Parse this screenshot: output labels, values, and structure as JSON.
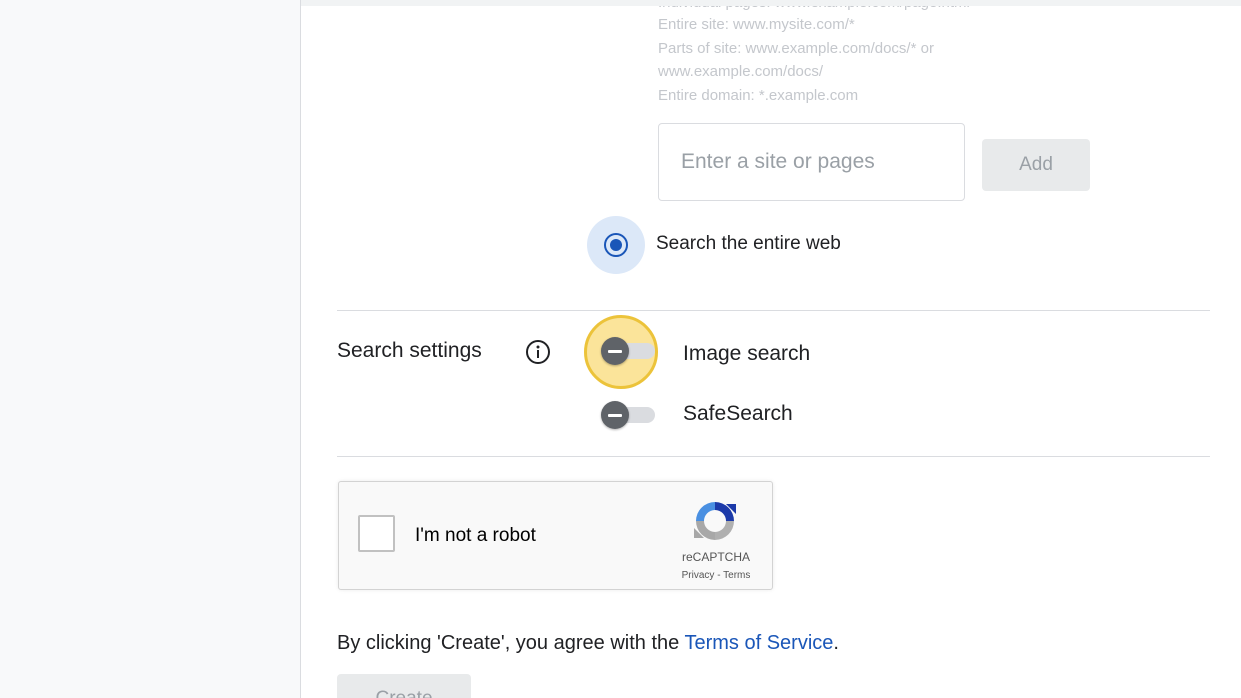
{
  "sites": {
    "hints": [
      "Individual pages: www.example.com/page.html",
      "Entire site: www.mysite.com/*",
      "Parts of site: www.example.com/docs/* or",
      "www.example.com/docs/",
      "Entire domain: *.example.com"
    ],
    "input_placeholder": "Enter a site or pages",
    "add_label": "Add",
    "entire_web_label": "Search the entire web"
  },
  "settings": {
    "label": "Search settings",
    "image_search_label": "Image search",
    "safesearch_label": "SafeSearch"
  },
  "captcha": {
    "label": "I'm not a robot",
    "brand": "reCAPTCHA",
    "privacy": "Privacy",
    "separator": " - ",
    "terms": "Terms"
  },
  "footer": {
    "agree_prefix": "By clicking 'Create', you agree with the ",
    "terms_link": "Terms of Service",
    "agree_suffix": ".",
    "create_label": "Create"
  },
  "colors": {
    "accent": "#1a56b8",
    "highlight": "#fbe49a",
    "toggle_thumb": "#5f6368"
  },
  "icons": {
    "info": "info-icon",
    "recaptcha": "recaptcha-logo-icon"
  }
}
